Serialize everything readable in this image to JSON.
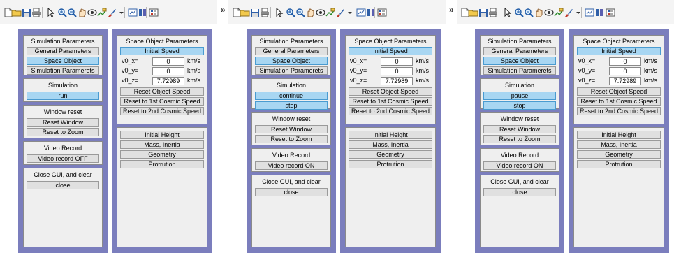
{
  "toolbar": {
    "icons": [
      "new-file-icon",
      "open-folder-icon",
      "save-icon",
      "print-icon",
      "pointer-icon",
      "zoom-in-icon",
      "zoom-out-icon",
      "pan-icon",
      "rotate-3d-icon",
      "data-cursor-icon",
      "brush-icon",
      "dropdown-arrow-icon",
      "link-plot-icon",
      "colorbar-icon",
      "legend-icon"
    ],
    "overflow": "»"
  },
  "left": {
    "sim_title": "Simulation Parameters",
    "general_label": "General Parameters",
    "space_object_label": "Space Object",
    "simulation_params_label": "Simulation Paramerets",
    "simulation_title": "Simulation",
    "window_reset_title": "Window reset",
    "reset_window_label": "Reset Window",
    "reset_zoom_label": "Reset to Zoom",
    "video_record_title": "Video Record",
    "close_title": "Close GUI, and clear",
    "close_label": "close"
  },
  "right": {
    "title": "Space Object Parameters",
    "initial_speed_label": "Initial Speed",
    "v0x_label": "v0_x=",
    "v0y_label": "v0_y=",
    "v0z_label": "v0_z=",
    "v0x_value": "0",
    "v0y_value": "0",
    "v0z_value": "7.72989",
    "unit": "km/s",
    "reset_object_speed_label": "Reset Object Speed",
    "reset_1st_label": "Reset to 1st Cosmic Speed",
    "reset_2nd_label": "Reset to 2nd Cosmic Speed",
    "initial_height_label": "Initial Height",
    "mass_inertia_label": "Mass, Inertia",
    "geometry_label": "Geometry",
    "protrution_label": "Protrution"
  },
  "states": [
    {
      "sim_buttons": [
        "run"
      ],
      "video_label": "Video record OFF"
    },
    {
      "sim_buttons": [
        "continue",
        "stop"
      ],
      "video_label": "Video record ON"
    },
    {
      "sim_buttons": [
        "pause",
        "stop"
      ],
      "video_label": "Video record ON"
    }
  ],
  "colors": {
    "panel": "#7b7ebd",
    "box": "#efefef",
    "selected": "#a8d6f2"
  }
}
